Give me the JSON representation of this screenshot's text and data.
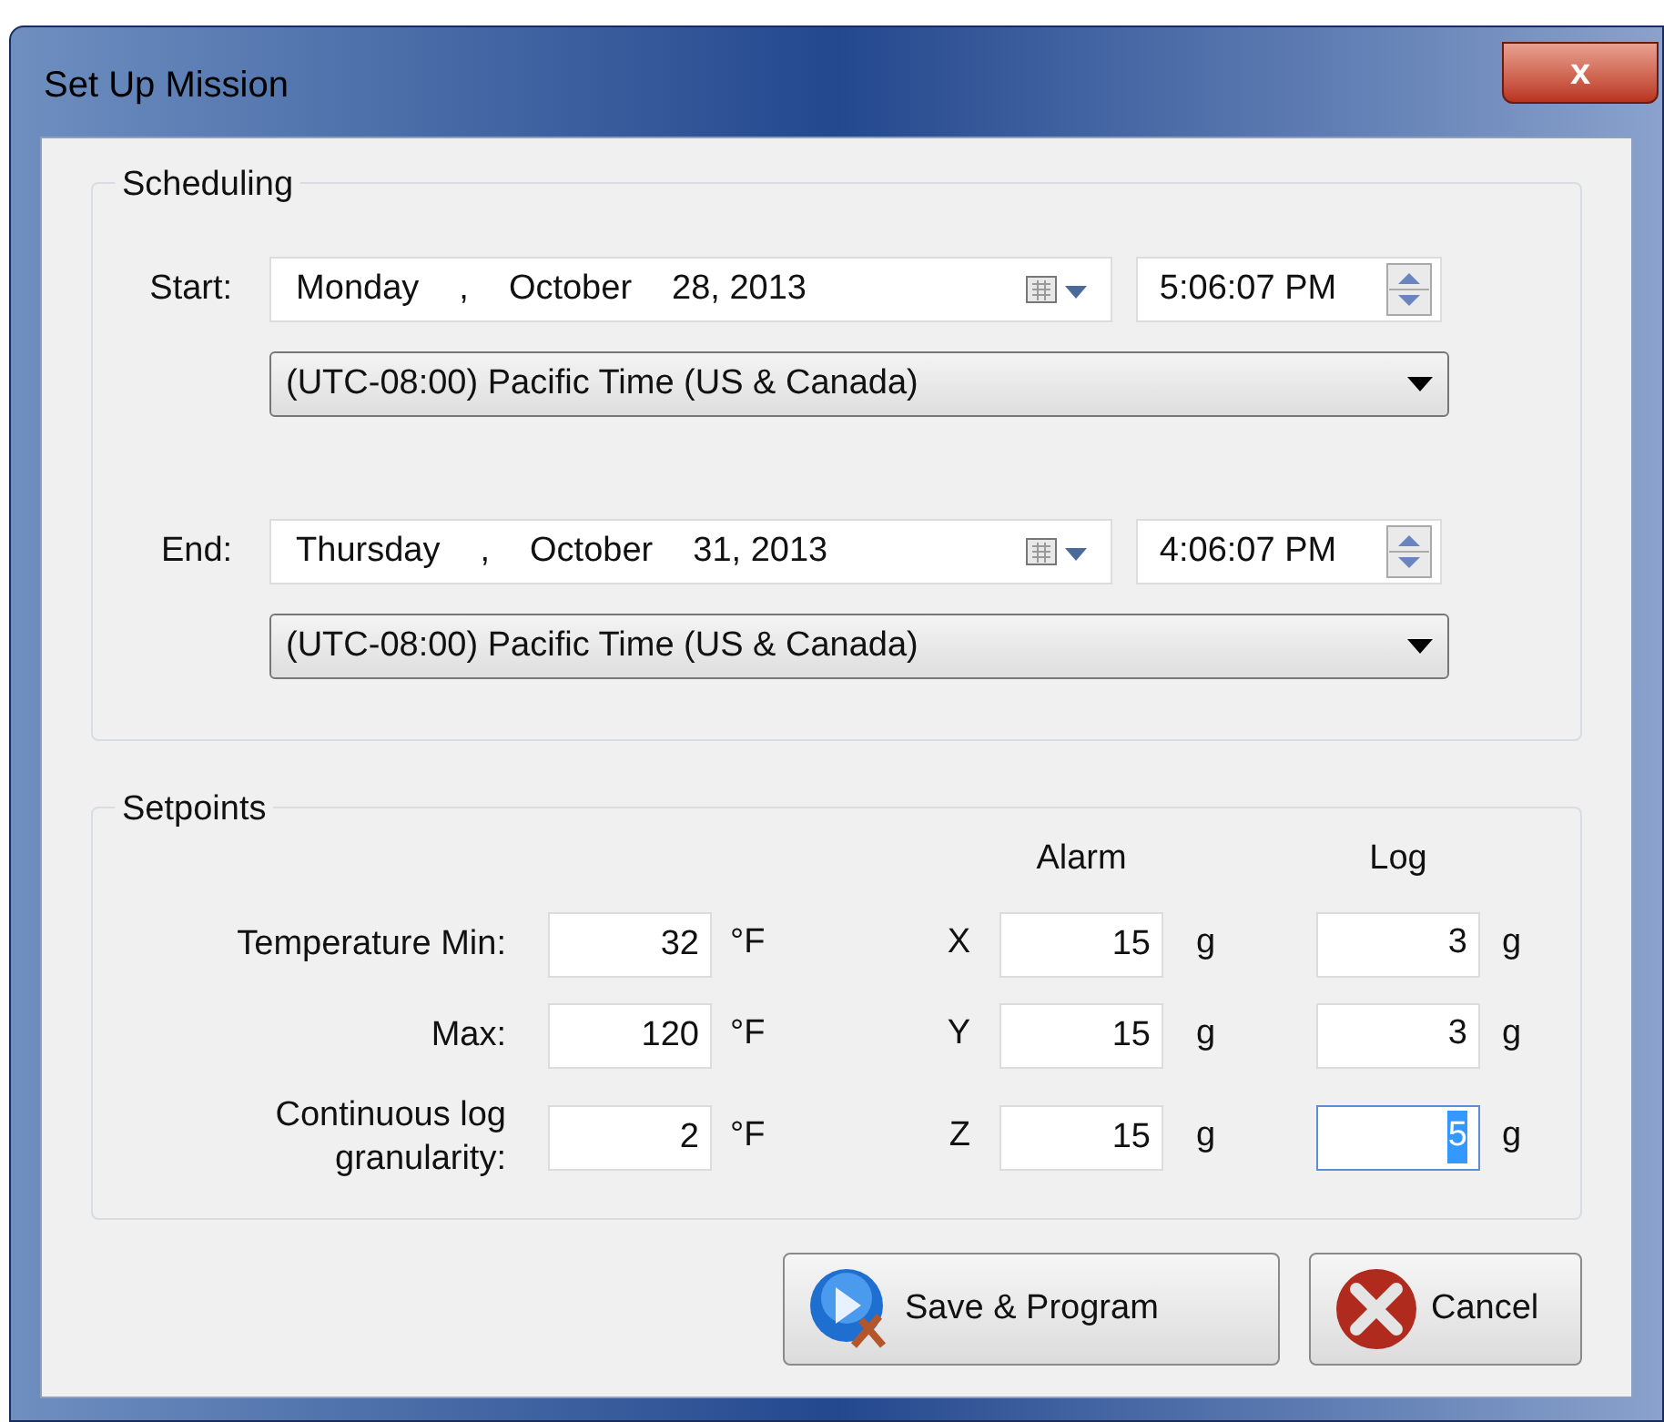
{
  "window": {
    "title": "Set Up Mission",
    "close": "x"
  },
  "scheduling": {
    "title": "Scheduling",
    "rows": [
      {
        "label": "Start:",
        "date_parts": [
          "Monday",
          ",",
          "October",
          "28, 2013"
        ],
        "time": "5:06:07 PM",
        "timezone": "(UTC-08:00) Pacific Time (US & Canada)"
      },
      {
        "label": "End:",
        "date_parts": [
          "Thursday",
          ",",
          "October",
          "31, 2013"
        ],
        "time": "4:06:07 PM",
        "timezone": "(UTC-08:00) Pacific Time (US & Canada)"
      }
    ]
  },
  "setpoints": {
    "title": "Setpoints",
    "columns": [
      "Alarm",
      "Log"
    ],
    "rows": [
      {
        "label": "Temperature Min:",
        "value": "32",
        "unit": "°F",
        "axis": "X",
        "alarm": "15",
        "alarm_unit": "g",
        "log": "3",
        "log_unit": "g",
        "log_focused": false
      },
      {
        "label": "Max:",
        "value": "120",
        "unit": "°F",
        "axis": "Y",
        "alarm": "15",
        "alarm_unit": "g",
        "log": "3",
        "log_unit": "g",
        "log_focused": false
      },
      {
        "label": "Continuous log granularity:",
        "value": "2",
        "unit": "°F",
        "axis": "Z",
        "alarm": "15",
        "alarm_unit": "g",
        "log": "5",
        "log_unit": "g",
        "log_focused": true
      }
    ]
  },
  "buttons": [
    {
      "label": "Save & Program",
      "kind": "save"
    },
    {
      "label": "Cancel",
      "kind": "cancel"
    }
  ]
}
